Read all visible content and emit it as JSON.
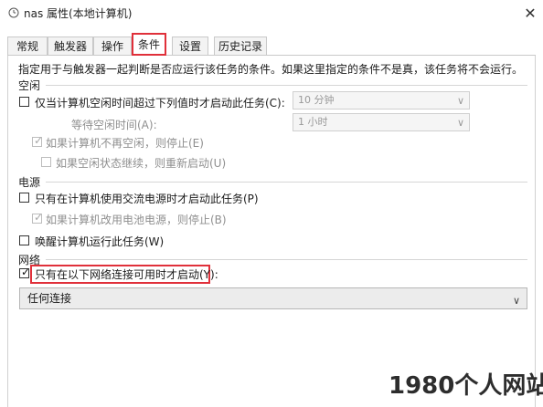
{
  "window": {
    "title": "nas 属性(本地计算机)",
    "close_glyph": "✕"
  },
  "tabs": [
    "常规",
    "触发器",
    "操作",
    "条件",
    "设置",
    "历史记录"
  ],
  "active_tab": "条件",
  "description": "指定用于与触发器一起判断是否应运行该任务的条件。如果这里指定的条件不是真，该任务将不会运行。",
  "idle": {
    "header": "空闲",
    "start_if_idle_label": "仅当计算机空闲时间超过下列值时才启动此任务(C):",
    "idle_for_value": "10 分钟",
    "wait_for_idle_label": "等待空闲时间(A):",
    "wait_for_idle_value": "1 小时",
    "stop_if_not_idle_label": "如果计算机不再空闲，则停止(E)",
    "restart_if_idle_resumes_label": "如果空闲状态继续，则重新启动(U)"
  },
  "power": {
    "header": "电源",
    "ac_power_label": "只有在计算机使用交流电源时才启动此任务(P)",
    "stop_on_battery_label": "如果计算机改用电池电源，则停止(B)",
    "wake_label": "唤醒计算机运行此任务(W)"
  },
  "network": {
    "header": "网络",
    "network_available_label": "只有在以下网络连接可用时才启动(Y):",
    "connection_value": "任何连接"
  },
  "checkmark": "✓",
  "chevron": "∨",
  "watermark": "1980个人网站",
  "colors": {
    "highlight": "#e0303a",
    "disabled_text": "#8f8f8f"
  }
}
